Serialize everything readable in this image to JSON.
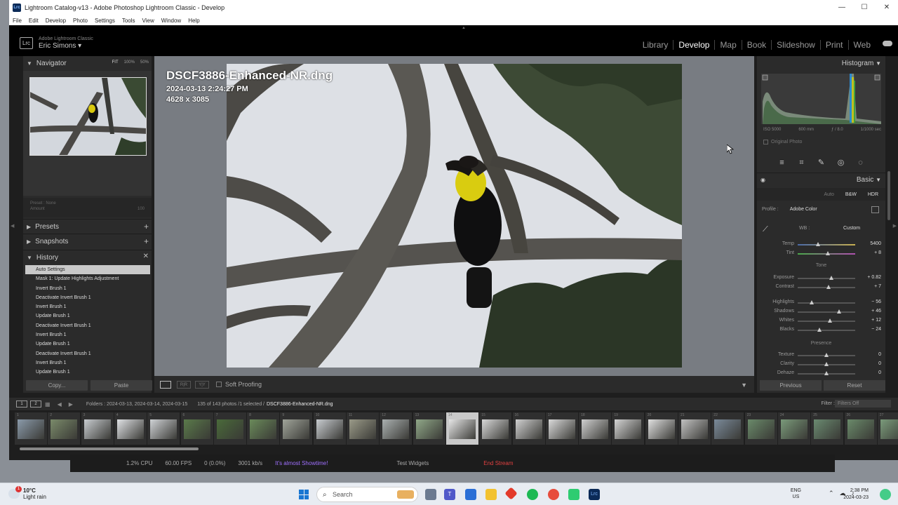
{
  "titlebar": {
    "title": "Lightroom Catalog-v13 - Adobe Photoshop Lightroom Classic - Develop",
    "app_badge": "Lrc"
  },
  "menu": [
    "File",
    "Edit",
    "Develop",
    "Photo",
    "Settings",
    "Tools",
    "View",
    "Window",
    "Help"
  ],
  "identity": {
    "app_name": "Adobe Lightroom Classic",
    "user": "Eric Simons",
    "badge": "Lrc"
  },
  "modules": [
    "Library",
    "Develop",
    "Map",
    "Book",
    "Slideshow",
    "Print",
    "Web"
  ],
  "active_module": "Develop",
  "navigator": {
    "title": "Navigator",
    "zoom": [
      "FIT",
      "100%",
      "50%"
    ]
  },
  "preset_amount": {
    "preset_label": "Preset : None",
    "amount_label": "Amount",
    "amount_value": "100"
  },
  "panels": {
    "presets": "Presets",
    "snapshots": "Snapshots",
    "history": "History"
  },
  "history": [
    "Auto Settings",
    "Mask 1: Update Highlights Adjustment",
    "Invert Brush 1",
    "Deactivate Invert Brush 1",
    "Invert Brush 1",
    "Update Brush 1",
    "Deactivate Invert Brush 1",
    "Invert Brush 1",
    "Update Brush 1",
    "Deactivate Invert Brush 1",
    "Invert Brush 1",
    "Update Brush 1"
  ],
  "buttons": {
    "copy": "Copy...",
    "paste": "Paste",
    "previous": "Previous",
    "reset": "Reset"
  },
  "photo": {
    "filename": "DSCF3886-Enhanced-NR.dng",
    "datetime": "2024-03-13 2:24:27 PM",
    "dimensions": "4628 x 3085"
  },
  "toolbar": {
    "soft_proofing": "Soft Proofing"
  },
  "histogram": {
    "title": "Histogram",
    "iso": "ISO 5000",
    "focal": "600 mm",
    "aperture": "ƒ / 8.0",
    "shutter": "1/1000 sec",
    "original_photo": "Original Photo"
  },
  "basic": {
    "title": "Basic",
    "treatment": [
      "Auto",
      "B&W",
      "HDR"
    ],
    "profile_label": "Profile :",
    "profile_value": "Adobe Color",
    "wb_label": "WB :",
    "wb_value": "Custom",
    "tone_label": "Tone",
    "presence_label": "Presence",
    "sliders": [
      {
        "label": "Temp",
        "value": "5400",
        "pos": 0.35
      },
      {
        "label": "Tint",
        "value": "+ 8",
        "pos": 0.53
      },
      {
        "label": "Exposure",
        "value": "+ 0.82",
        "pos": 0.58
      },
      {
        "label": "Contrast",
        "value": "+ 7",
        "pos": 0.54
      },
      {
        "label": "Highlights",
        "value": "− 56",
        "pos": 0.24
      },
      {
        "label": "Shadows",
        "value": "+ 46",
        "pos": 0.72
      },
      {
        "label": "Whites",
        "value": "+ 12",
        "pos": 0.56
      },
      {
        "label": "Blacks",
        "value": "− 24",
        "pos": 0.38
      },
      {
        "label": "Texture",
        "value": "0",
        "pos": 0.5
      },
      {
        "label": "Clarity",
        "value": "0",
        "pos": 0.5
      },
      {
        "label": "Dehaze",
        "value": "0",
        "pos": 0.5
      }
    ]
  },
  "filmstrip": {
    "folders": "Folders : 2024-03-13, 2024-03-14, 2024-03-15",
    "count": "135 of 143 photos /1 selected /",
    "current": "DSCF3886-Enhanced-NR.dng",
    "filter_label": "Filter :",
    "filter_value": "Filters Off",
    "cells": [
      "1",
      "2",
      "3",
      "4",
      "5",
      "6",
      "7",
      "8",
      "9",
      "10",
      "11",
      "12",
      "13",
      "14",
      "15",
      "16",
      "17",
      "18",
      "19",
      "20",
      "21",
      "22",
      "23",
      "24",
      "25",
      "26",
      "27"
    ],
    "selected_index": 13
  },
  "obs": {
    "cpu": "1.2% CPU",
    "fps": "60.00 FPS",
    "dropped": "0 (0.0%)",
    "kbps": "3001 kb/s",
    "status": "It's almost Showtime!",
    "test": "Test Widgets",
    "end": "End Stream"
  },
  "taskbar": {
    "weather_temp": "10°C",
    "weather_desc": "Light rain",
    "weather_badge": "1",
    "search_placeholder": "Search",
    "lang1": "ENG",
    "lang2": "US",
    "time": "2:38 PM",
    "date": "2024-03-23"
  },
  "colors": {
    "accent_active": "#ffffff",
    "panel_bg": "#2b2b2b",
    "history_selected": "#c9c9c9"
  }
}
